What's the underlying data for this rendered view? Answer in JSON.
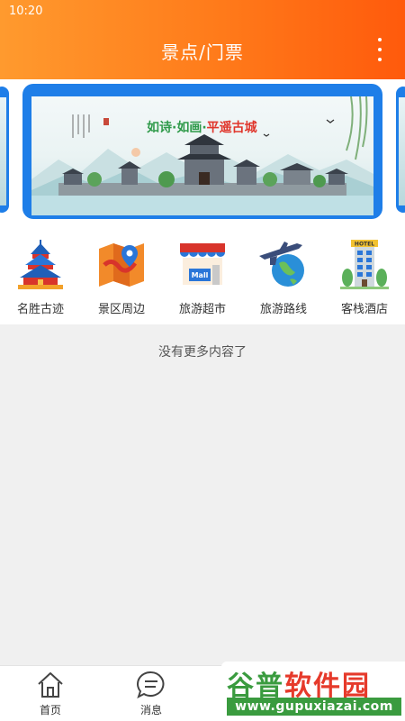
{
  "status_bar": {
    "time": "10:20"
  },
  "header": {
    "title": "景点/门票",
    "more_icon": "more-vertical-icon"
  },
  "banner": {
    "caption_part1": "如诗·如画·",
    "caption_part2": "平遥古城",
    "slide_count": 2,
    "active_slide": 1
  },
  "categories": [
    {
      "label": "名胜古迹",
      "icon": "temple-icon"
    },
    {
      "label": "景区周边",
      "icon": "map-location-icon"
    },
    {
      "label": "旅游超市",
      "icon": "mall-store-icon"
    },
    {
      "label": "旅游路线",
      "icon": "airplane-globe-icon"
    },
    {
      "label": "客栈酒店",
      "icon": "hotel-icon"
    }
  ],
  "empty_message": "没有更多内容了",
  "hotel_sign": "HOTEL",
  "mall_sign": "Mall",
  "bottom_nav": [
    {
      "label": "首页",
      "icon": "home-icon"
    },
    {
      "label": "消息",
      "icon": "message-icon"
    }
  ],
  "watermark": {
    "line1_green": "谷普",
    "line1_red": "软件园",
    "line2": "www.gupuxiazai.com"
  },
  "colors": {
    "header_start": "#ff9a2e",
    "header_end": "#ff5a0c",
    "banner_frame": "#1e7ee8",
    "accent": "#ff7a1a"
  }
}
